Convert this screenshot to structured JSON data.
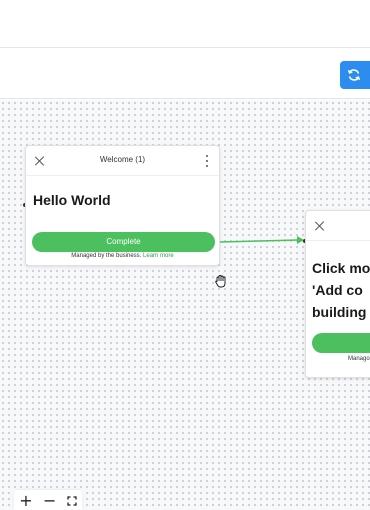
{
  "header": {
    "sync_button_icon": "sync-icon",
    "accent_color": "#2d8cf0"
  },
  "canvas": {
    "cards": [
      {
        "title": "Welcome (1)",
        "body": "Hello World",
        "complete_label": "Complete",
        "managed_text": "Managed by the business.",
        "learn_more_label": "Learn more",
        "close_icon": "close-icon",
        "menu_icon": "kebab-menu-icon"
      },
      {
        "body_line1": "Click mo",
        "body_line2": "'Add co",
        "body_line3": "building",
        "managed_text": "Manago",
        "close_icon": "close-icon"
      }
    ],
    "connector_color": "#4cbf5e",
    "button_color": "#4cbf5e"
  },
  "zoom_controls": {
    "zoom_in": "+",
    "zoom_out": "−",
    "fit_icon": "fullscreen-icon"
  }
}
